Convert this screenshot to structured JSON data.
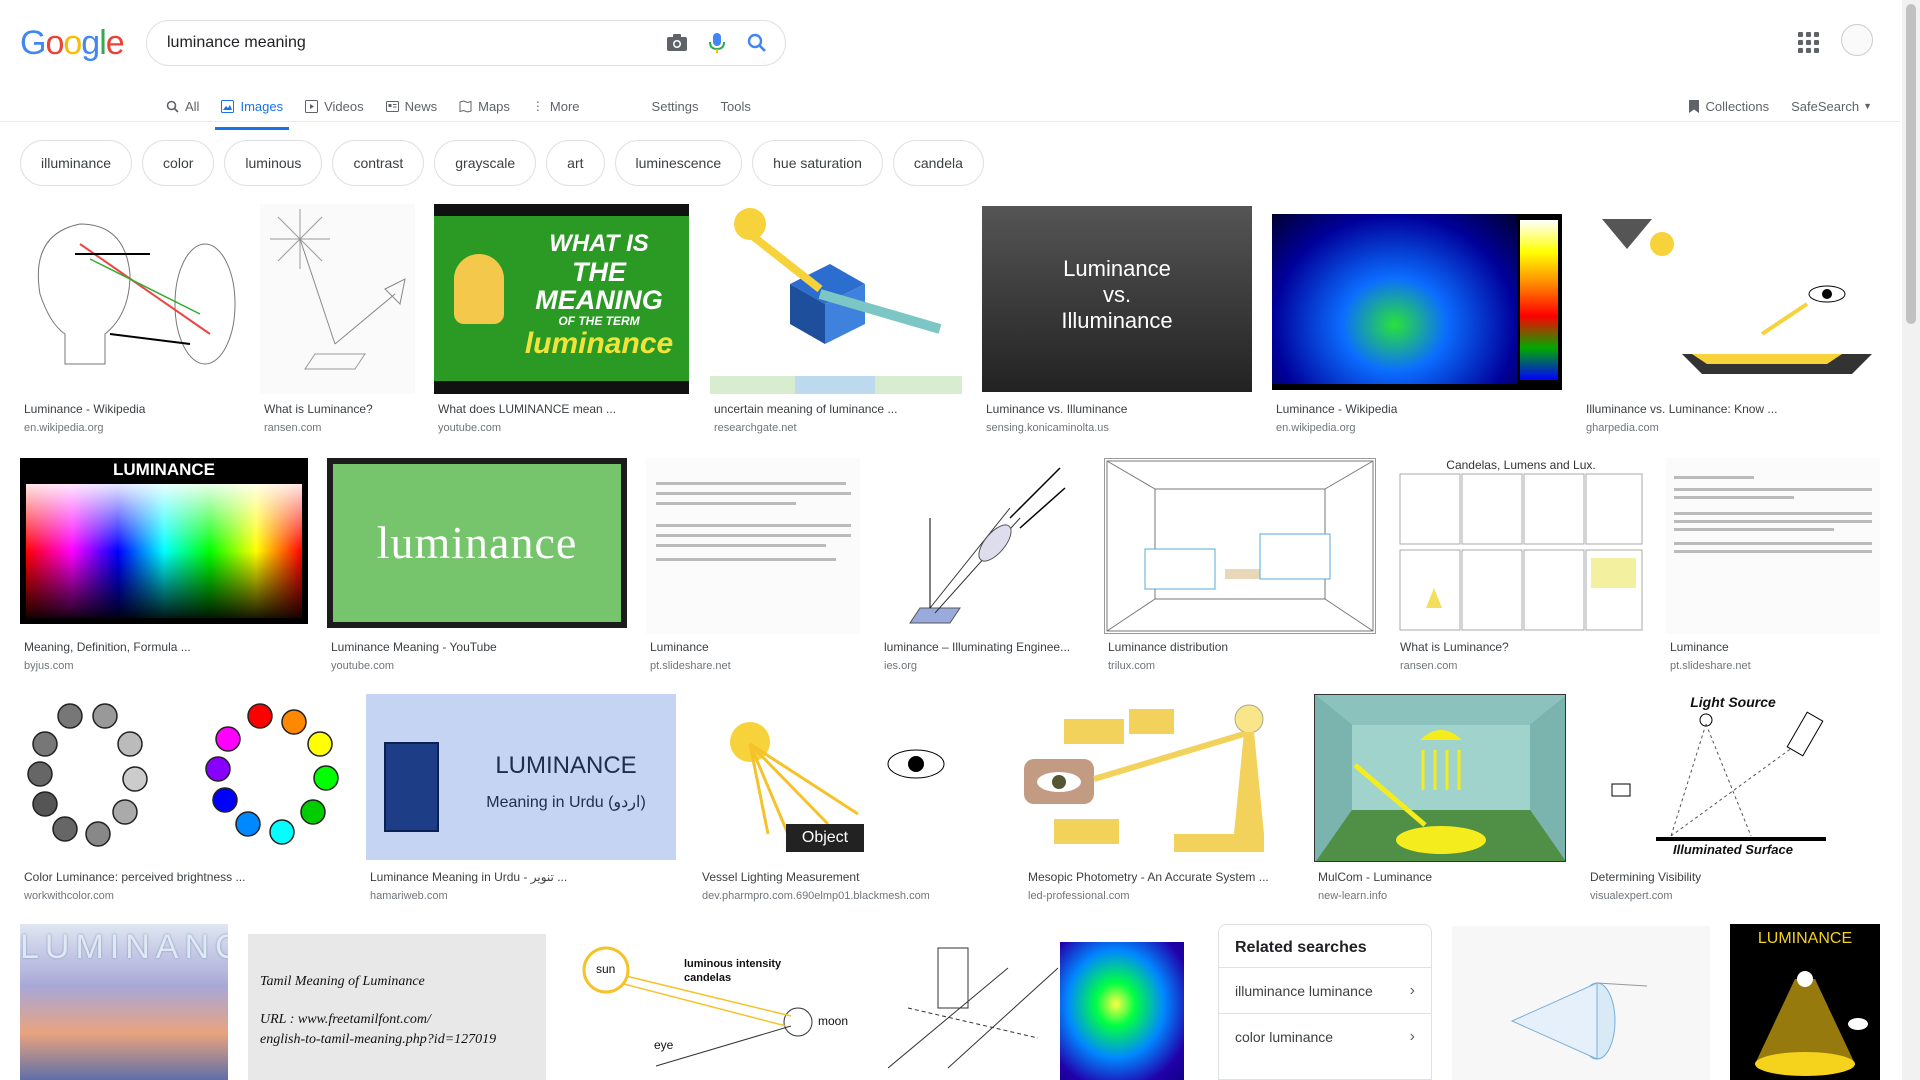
{
  "header": {
    "logo_letters": [
      "G",
      "o",
      "o",
      "g",
      "l",
      "e"
    ],
    "logo_colors": [
      "#4285F4",
      "#EA4335",
      "#FBBC05",
      "#4285F4",
      "#34A853",
      "#EA4335"
    ],
    "query": "luminance meaning"
  },
  "tabs": [
    {
      "label": "All",
      "icon": "search-icon"
    },
    {
      "label": "Images",
      "icon": "image-icon"
    },
    {
      "label": "Videos",
      "icon": "video-icon"
    },
    {
      "label": "News",
      "icon": "news-icon"
    },
    {
      "label": "Maps",
      "icon": "map-icon"
    },
    {
      "label": "More",
      "icon": "more-vert-icon"
    }
  ],
  "settings_label": "Settings",
  "tools_label": "Tools",
  "collections_label": "Collections",
  "safesearch_label": "SafeSearch",
  "chips": [
    "illuminance",
    "color",
    "luminous",
    "contrast",
    "grayscale",
    "art",
    "luminescence",
    "hue saturation",
    "candela"
  ],
  "results": [
    {
      "title": "Luminance - Wikipedia",
      "source": "en.wikipedia.org"
    },
    {
      "title": "What is Luminance?",
      "source": "ransen.com"
    },
    {
      "title": "What does LUMINANCE mean ...",
      "source": "youtube.com"
    },
    {
      "title": "uncertain meaning of luminance ...",
      "source": "researchgate.net"
    },
    {
      "title": "Luminance vs. Illuminance",
      "source": "sensing.konicaminolta.us"
    },
    {
      "title": "Luminance - Wikipedia",
      "source": "en.wikipedia.org"
    },
    {
      "title": "Illuminance vs. Luminance: Know ...",
      "source": "gharpedia.com"
    },
    {
      "title": "Meaning, Definition, Formula ...",
      "source": "byjus.com"
    },
    {
      "title": "Luminance Meaning - YouTube",
      "source": "youtube.com"
    },
    {
      "title": "Luminance",
      "source": "pt.slideshare.net"
    },
    {
      "title": "luminance – Illuminating Enginee...",
      "source": "ies.org"
    },
    {
      "title": "Luminance distribution",
      "source": "trilux.com"
    },
    {
      "title": "What is Luminance?",
      "source": "ransen.com"
    },
    {
      "title": "Luminance",
      "source": "pt.slideshare.net"
    },
    {
      "title": "Color Luminance: perceived brightness ...",
      "source": "workwithcolor.com"
    },
    {
      "title": "Luminance Meaning in Urdu - تنویر ...",
      "source": "hamariweb.com"
    },
    {
      "title": "Vessel Lighting Measurement",
      "source": "dev.pharmpro.com.690elmp01.blackmesh.com"
    },
    {
      "title": "Mesopic Photometry - An Accurate System ...",
      "source": "led-professional.com"
    },
    {
      "title": "MulCom - Luminance",
      "source": "new-learn.info"
    },
    {
      "title": "Determining Visibility",
      "source": "visualexpert.com"
    }
  ],
  "thumb_text": {
    "meaning_line1": "WHAT IS",
    "meaning_line2": "THE MEANING",
    "meaning_line3": "OF THE TERM",
    "meaning_line4": "luminance",
    "vs_line1": "Luminance",
    "vs_line2": "vs.",
    "vs_line3": "Illuminance",
    "luminance_bar": "LUMINANCE",
    "luminance_big": "luminance",
    "urdu_line1": "LUMINANCE",
    "urdu_line2": "Meaning in Urdu (اردو)",
    "object_label": "Object",
    "light_source": "Light Source",
    "illuminated_surface": "Illuminated Surface",
    "candelas_title": "Candelas, Lumens and Lux.",
    "tamil_line1": "Tamil Meaning of Luminance",
    "tamil_line2": "URL : www.freetamilfont.com/",
    "tamil_line3": "english-to-tamil-meaning.php?id=127019",
    "luminance_spaced": "LUMINANCE",
    "luminance_yellow": "LUMINANCE",
    "luminous_intensity": "luminous intensity",
    "candelas": "candelas",
    "sun": "sun",
    "moon": "moon",
    "eye": "eye"
  },
  "related": {
    "heading": "Related searches",
    "items": [
      "illuminance luminance",
      "color luminance"
    ]
  }
}
